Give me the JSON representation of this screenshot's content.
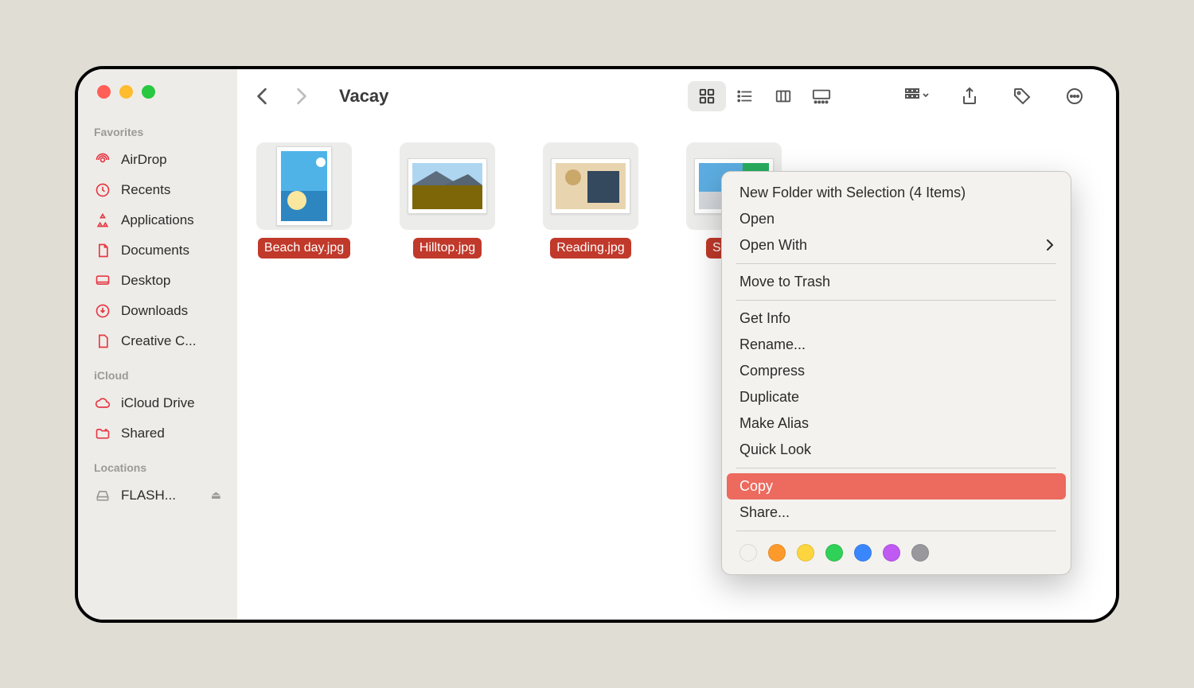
{
  "sidebar": {
    "favorites_header": "Favorites",
    "icloud_header": "iCloud",
    "locations_header": "Locations",
    "favorites": [
      {
        "label": "AirDrop"
      },
      {
        "label": "Recents"
      },
      {
        "label": "Applications"
      },
      {
        "label": "Documents"
      },
      {
        "label": "Desktop"
      },
      {
        "label": "Downloads"
      },
      {
        "label": "Creative C..."
      }
    ],
    "icloud": [
      {
        "label": "iCloud Drive"
      },
      {
        "label": "Shared"
      }
    ],
    "locations": [
      {
        "label": "FLASH..."
      }
    ]
  },
  "toolbar": {
    "title": "Vacay"
  },
  "files": [
    {
      "name": "Beach day.jpg"
    },
    {
      "name": "Hilltop.jpg"
    },
    {
      "name": "Reading.jpg"
    },
    {
      "name": "Sun bathing"
    }
  ],
  "context_menu": {
    "items": [
      {
        "label": "New Folder with Selection (4 Items)"
      },
      {
        "label": "Open"
      },
      {
        "label": "Open With",
        "has_submenu": true
      }
    ],
    "trash": {
      "label": "Move to Trash"
    },
    "info_items": [
      {
        "label": "Get Info"
      },
      {
        "label": "Rename..."
      },
      {
        "label": "Compress"
      },
      {
        "label": "Duplicate"
      },
      {
        "label": "Make Alias"
      },
      {
        "label": "Quick Look"
      }
    ],
    "copy": {
      "label": "Copy"
    },
    "share": {
      "label": "Share..."
    },
    "tag_colors": [
      "#ff5f57",
      "#fd9a2b",
      "#fcd53f",
      "#30d158",
      "#3a87fd",
      "#bf5af2",
      "#98989d"
    ]
  }
}
